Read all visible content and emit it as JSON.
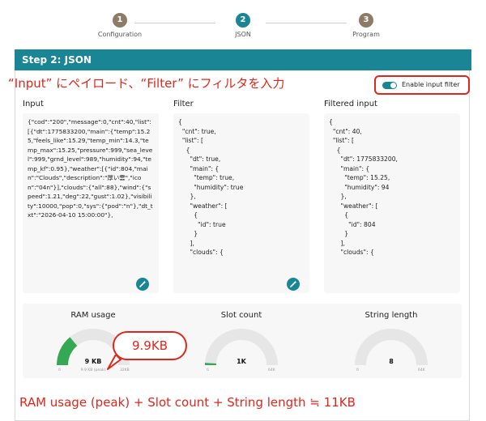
{
  "stepper": {
    "steps": [
      {
        "number": "1",
        "label": "Configuration"
      },
      {
        "number": "2",
        "label": "JSON"
      },
      {
        "number": "3",
        "label": "Program"
      }
    ]
  },
  "card": {
    "title": "Step 2: JSON"
  },
  "annotations": {
    "top": "“Input” にペイロード、“Filter” にフィルタを入力",
    "bubble": "9.9KB",
    "bottom": "RAM usage (peak) + Slot count + String length ≒ 11KB"
  },
  "toggle": {
    "label": "Enable input filter",
    "enabled": true
  },
  "columns": {
    "input_title": "Input",
    "filter_title": "Filter",
    "filtered_title": "Filtered input"
  },
  "input_text": "{\"cod\":\"200\",\"message\":0,\"cnt\":40,\"list\":[{\"dt\":1775833200,\"main\":{\"temp\":15.25,\"feels_like\":15.29,\"temp_min\":14.3,\"temp_max\":15.25,\"pressure\":999,\"sea_level\":999,\"grnd_level\":989,\"humidity\":94,\"temp_kf\":0.95},\"weather\":[{\"id\":804,\"main\":\"Clouds\",\"description\":\"厚い雲\",\"icon\":\"04n\"}],\"clouds\":{\"all\":88},\"wind\":{\"speed\":1.21,\"deg\":22,\"gust\":1.02},\"visibility\":10000,\"pop\":0,\"sys\":{\"pod\":\"n\"},\"dt_txt\":\"2026-04-10 15:00:00\"},",
  "filter_text": "{\n  \"cnt\": true,\n  \"list\": [\n    {\n      \"dt\": true,\n      \"main\": {\n        \"temp\": true,\n        \"humidity\": true\n      },\n      \"weather\": [\n        {\n          \"id\": true\n        }\n      ],\n      \"clouds\": {",
  "filtered_text": "{\n  \"cnt\": 40,\n  \"list\": [\n    {\n      \"dt\": 1775833200,\n      \"main\": {\n        \"temp\": 15.25,\n        \"humidity\": 94\n      },\n      \"weather\": [\n        {\n          \"id\": 804\n        }\n      ],\n      \"clouds\": {",
  "gauges": [
    {
      "title": "RAM usage",
      "value": "9 KB",
      "sub": "9.9 KB (peak)",
      "min": "0",
      "max": "32KB",
      "fraction": 0.28,
      "color": "#34a853"
    },
    {
      "title": "Slot count",
      "value": "1K",
      "sub": "",
      "min": "0",
      "max": "64K",
      "fraction": 0.02,
      "color": "#34a853"
    },
    {
      "title": "String length",
      "value": "8",
      "sub": "",
      "min": "0",
      "max": "64K",
      "fraction": 0.0,
      "color": "#34a853"
    }
  ],
  "colors": {
    "accent": "#1a8594",
    "annotation": "#e0261b",
    "gauge_track": "#e6e6e6"
  },
  "icons": {
    "wand": "magic-wand-icon"
  }
}
